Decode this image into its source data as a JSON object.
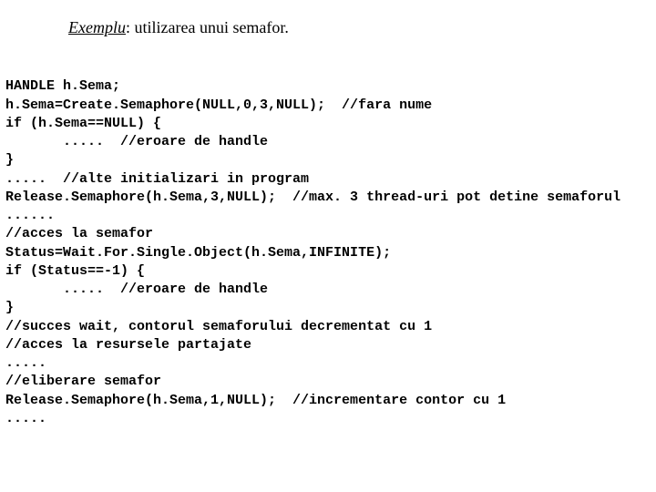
{
  "heading": {
    "italic_underline": "Exemplu",
    "rest": ": utilizarea unui semafor."
  },
  "code": {
    "line1": "HANDLE h.Sema;",
    "line2": "h.Sema=Create.Semaphore(NULL,0,3,NULL);  //fara nume",
    "line3": "if (h.Sema==NULL) {",
    "line4": "       .....  //eroare de handle",
    "line5": "}",
    "line6": ".....  //alte initializari in program",
    "line7": "Release.Semaphore(h.Sema,3,NULL);  //max. 3 thread-uri pot detine semaforul",
    "line8": "......",
    "line9": "//acces la semafor",
    "line10": "Status=Wait.For.Single.Object(h.Sema,INFINITE);",
    "line11": "if (Status==-1) {",
    "line12": "       .....  //eroare de handle",
    "line13": "}",
    "line14": "//succes wait, contorul semaforului decrementat cu 1",
    "line15": "//acces la resursele partajate",
    "line16": ".....",
    "line17": "//eliberare semafor",
    "line18": "Release.Semaphore(h.Sema,1,NULL);  //incrementare contor cu 1",
    "line19": "....."
  }
}
